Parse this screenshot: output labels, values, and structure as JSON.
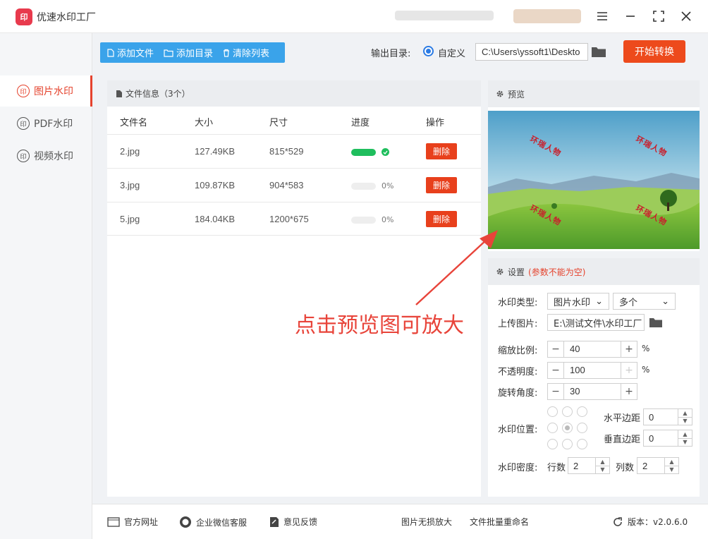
{
  "app": {
    "title": "优速水印工厂",
    "logo_glyph": "印"
  },
  "window_controls": [
    "menu-icon",
    "minimize-icon",
    "maximize-icon",
    "close-icon"
  ],
  "sidebar": {
    "items": [
      {
        "label": "图片水印",
        "icon": "印",
        "active": true
      },
      {
        "label": "PDF水印",
        "icon": "印",
        "active": false
      },
      {
        "label": "视频水印",
        "icon": "印",
        "active": false
      }
    ]
  },
  "toolbar": {
    "add_file": "添加文件",
    "add_dir": "添加目录",
    "clear_list": "清除列表",
    "output_label": "输出目录:",
    "output_option": "自定义",
    "output_path": "C:\\Users\\yssoft1\\Deskto",
    "start": "开始转换"
  },
  "file_panel": {
    "title": "文件信息（3个）",
    "columns": [
      "文件名",
      "大小",
      "尺寸",
      "进度",
      "操作"
    ],
    "rows": [
      {
        "name": "2.jpg",
        "size": "127.49KB",
        "dims": "815*529",
        "progress": 1.0,
        "pct": "",
        "action": "删除"
      },
      {
        "name": "3.jpg",
        "size": "109.87KB",
        "dims": "904*583",
        "progress": 0,
        "pct": "0%",
        "action": "删除"
      },
      {
        "name": "5.jpg",
        "size": "184.04KB",
        "dims": "1200*675",
        "progress": 0,
        "pct": "0%",
        "action": "删除"
      }
    ]
  },
  "preview": {
    "title": "预览",
    "watermark_text": "环瑞人物"
  },
  "annotation": "点击预览图可放大",
  "settings": {
    "title": "设置",
    "note": "(参数不能为空)",
    "type_label": "水印类型:",
    "type_value": "图片水印",
    "count_value": "多个",
    "upload_label": "上传图片:",
    "upload_path": "E:\\测试文件\\水印工厂",
    "scale_label": "缩放比例:",
    "scale_value": "40",
    "opacity_label": "不透明度:",
    "opacity_value": "100",
    "rotate_label": "旋转角度:",
    "rotate_value": "30",
    "percent": "%",
    "position_label": "水印位置:",
    "h_margin_label": "水平边距",
    "h_margin_value": "0",
    "v_margin_label": "垂直边距",
    "v_margin_value": "0",
    "density_label": "水印密度:",
    "rows_label": "行数",
    "rows_value": "2",
    "cols_label": "列数",
    "cols_value": "2"
  },
  "footer": {
    "website": "官方网址",
    "wechat": "企业微信客服",
    "feedback": "意见反馈",
    "lossless": "图片无损放大",
    "rename": "文件批量重命名",
    "version": "版本：v2.0.6.0"
  },
  "colors": {
    "accent": "#e5432d",
    "blue": "#3aa3ea",
    "start": "#ed4a1c",
    "progress": "#1fbe5d"
  }
}
